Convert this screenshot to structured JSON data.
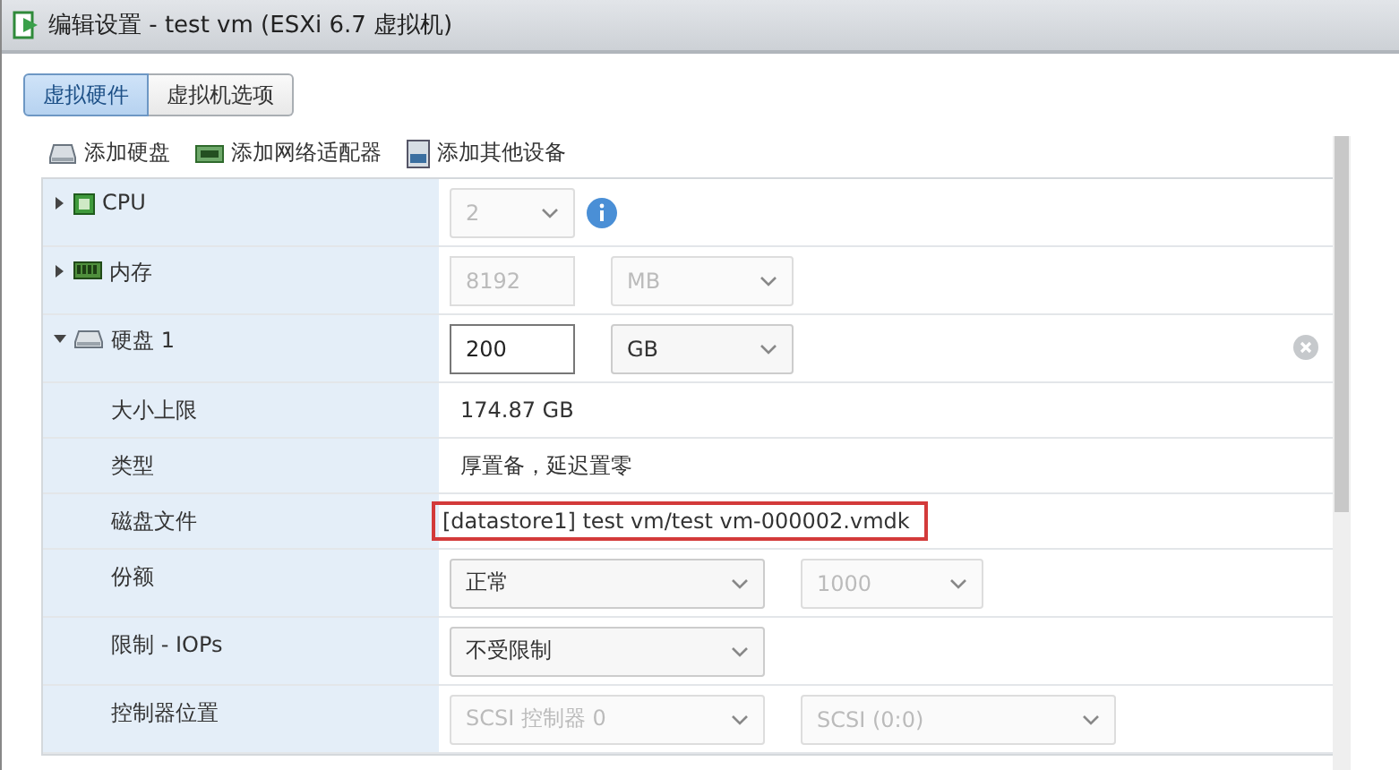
{
  "window": {
    "title": "编辑设置 - test vm (ESXi 6.7 虚拟机)"
  },
  "tabs": [
    {
      "label": "虚拟硬件",
      "selected": true
    },
    {
      "label": "虚拟机选项",
      "selected": false
    }
  ],
  "toolbar": [
    {
      "label": "添加硬盘",
      "kind": "disk"
    },
    {
      "label": "添加网络适配器",
      "kind": "nic"
    },
    {
      "label": "添加其他设备",
      "kind": "device"
    }
  ],
  "rows": [
    {
      "label": "CPU",
      "kind": "cpu",
      "expanded": false,
      "controls": [
        {
          "kind": "tiny-select",
          "value": "2",
          "disabled": true
        }
      ],
      "info": true
    },
    {
      "label": "内存",
      "kind": "memory",
      "expanded": false,
      "controls": [
        {
          "kind": "input",
          "value": "8192",
          "disabled": true
        },
        {
          "kind": "small-select",
          "value": "MB",
          "disabled": true
        }
      ]
    },
    {
      "label": "硬盘 1",
      "kind": "disk",
      "expanded": true,
      "removable": true,
      "controls": [
        {
          "kind": "input",
          "value": "200",
          "disabled": false
        },
        {
          "kind": "small-select",
          "value": "GB",
          "disabled": false
        }
      ]
    },
    {
      "label": "大小上限",
      "text": "174.87 GB"
    },
    {
      "label": "类型",
      "text": "厚置备，延迟置零"
    },
    {
      "label": "磁盘文件",
      "text": "[datastore1] test vm/test vm-000002.vmdk",
      "highlighted": true
    },
    {
      "label": "份额",
      "controls": [
        {
          "kind": "select",
          "value": "正常",
          "disabled": false
        },
        {
          "kind": "small-select",
          "value": "1000",
          "disabled": true
        }
      ]
    },
    {
      "label": "限制 - IOPs",
      "controls": [
        {
          "kind": "select",
          "value": "不受限制",
          "disabled": false
        }
      ]
    },
    {
      "label": "控制器位置",
      "controls": [
        {
          "kind": "select",
          "value": "SCSI 控制器 0",
          "disabled": true
        },
        {
          "kind": "select",
          "value": "SCSI (0:0)",
          "disabled": true
        }
      ]
    }
  ]
}
